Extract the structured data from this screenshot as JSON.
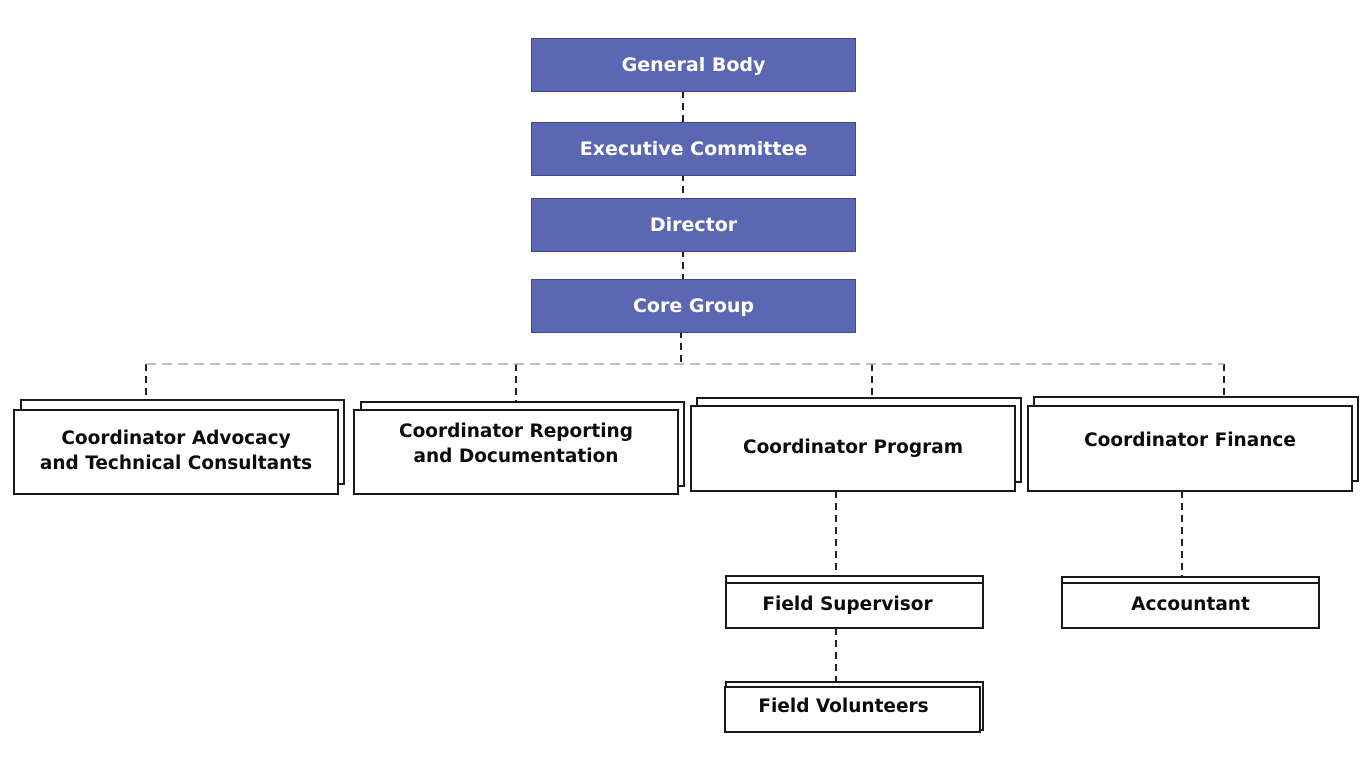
{
  "chart": {
    "type": "org-chart",
    "primary_color": "#5b67b3",
    "levels": [
      {
        "id": "general-body",
        "label": "General Body"
      },
      {
        "id": "executive-committee",
        "label": "Executive Committee"
      },
      {
        "id": "director",
        "label": "Director"
      },
      {
        "id": "core-group",
        "label": "Core Group"
      }
    ],
    "coordinators": [
      {
        "id": "coordinator-advocacy",
        "label_line1": "Coordinator Advocacy",
        "label_line2": "and Technical Consultants"
      },
      {
        "id": "coordinator-reporting",
        "label_line1": "Coordinator Reporting",
        "label_line2": "and Documentation"
      },
      {
        "id": "coordinator-program",
        "label_line1": "Coordinator Program",
        "label_line2": ""
      },
      {
        "id": "coordinator-finance",
        "label_line1": "Coordinator Finance",
        "label_line2": ""
      }
    ],
    "sub_units": [
      {
        "id": "field-supervisor",
        "label": "Field Supervisor",
        "parent": "coordinator-program"
      },
      {
        "id": "field-volunteers",
        "label": "Field Volunteers",
        "parent": "field-supervisor"
      },
      {
        "id": "accountant",
        "label": "Accountant",
        "parent": "coordinator-finance"
      }
    ]
  }
}
